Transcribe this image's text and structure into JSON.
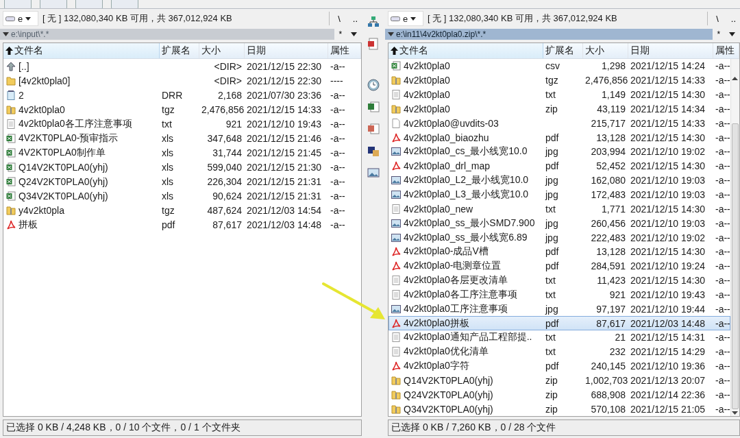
{
  "panels": [
    {
      "active": false,
      "drive": "e",
      "free": "[ 无 ] 132,080,340 KB 可用，共 367,012,924 KB",
      "root": "\\",
      "up": "..",
      "path": "e:\\input\\*.*",
      "filter": "*",
      "columns": [
        {
          "label": "文件名",
          "sorted": true
        },
        {
          "label": "扩展名",
          "sorted": false
        },
        {
          "label": "大小",
          "sorted": false
        },
        {
          "label": "日期",
          "sorted": false
        },
        {
          "label": "属性",
          "sorted": false
        }
      ],
      "rows": [
        {
          "kind": "parent",
          "name": "[..]",
          "size": "<DIR>",
          "date": "2021/12/15 22:30",
          "attr": "-a--",
          "selected": false
        },
        {
          "kind": "folder",
          "name": "[4v2kt0pla0]",
          "size": "<DIR>",
          "date": "2021/12/15 22:30",
          "attr": "----",
          "selected": false
        },
        {
          "kind": "note",
          "name": "2",
          "ext": "DRR",
          "size": "2,168",
          "date": "2021/07/30 23:36",
          "attr": "-a--",
          "selected": false
        },
        {
          "kind": "archive",
          "name": "4v2kt0pla0",
          "ext": "tgz",
          "size": "2,476,856",
          "date": "2021/12/15 14:33",
          "attr": "-a--",
          "selected": false
        },
        {
          "kind": "text",
          "name": "4v2kt0pla0各工序注意事项",
          "ext": "txt",
          "size": "921",
          "date": "2021/12/10 19:43",
          "attr": "-a--",
          "selected": false
        },
        {
          "kind": "sheet",
          "name": "4V2KT0PLA0-预审指示",
          "ext": "xls",
          "size": "347,648",
          "date": "2021/12/15 21:46",
          "attr": "-a--",
          "selected": false
        },
        {
          "kind": "sheet",
          "name": "4V2KT0PLA0制作单",
          "ext": "xls",
          "size": "31,744",
          "date": "2021/12/15 21:45",
          "attr": "-a--",
          "selected": false
        },
        {
          "kind": "sheet",
          "name": "Q14V2KT0PLA0(yhj)",
          "ext": "xls",
          "size": "599,040",
          "date": "2021/12/15 21:30",
          "attr": "-a--",
          "selected": false
        },
        {
          "kind": "sheet",
          "name": "Q24V2KT0PLA0(yhj)",
          "ext": "xls",
          "size": "226,304",
          "date": "2021/12/15 21:31",
          "attr": "-a--",
          "selected": false
        },
        {
          "kind": "sheet",
          "name": "Q34V2KT0PLA0(yhj)",
          "ext": "xls",
          "size": "90,624",
          "date": "2021/12/15 21:31",
          "attr": "-a--",
          "selected": false
        },
        {
          "kind": "archive",
          "name": "y4v2kt0pla",
          "ext": "tgz",
          "size": "487,624",
          "date": "2021/12/03 14:54",
          "attr": "-a--",
          "selected": false
        },
        {
          "kind": "pdf",
          "name": "拼板",
          "ext": "pdf",
          "size": "87,617",
          "date": "2021/12/03 14:48",
          "attr": "-a--",
          "selected": false
        }
      ],
      "status": "已选择 0 KB / 4,248 KB，0 / 10 个文件，0 / 1 个文件夹"
    },
    {
      "active": true,
      "drive": "e",
      "free": "[ 无 ] 132,080,340 KB 可用，共 367,012,924 KB",
      "root": "\\",
      "up": "..",
      "path": "e:\\in11\\4v2kt0pla0.zip\\*.*",
      "filter": "*",
      "columns": [
        {
          "label": "文件名",
          "sorted": true
        },
        {
          "label": "扩展名",
          "sorted": false
        },
        {
          "label": "大小",
          "sorted": false
        },
        {
          "label": "日期",
          "sorted": false
        },
        {
          "label": "属性",
          "sorted": false
        }
      ],
      "rows": [
        {
          "kind": "csv",
          "name": "4v2kt0pla0",
          "ext": "csv",
          "size": "1,298",
          "date": "2021/12/15 14:24",
          "attr": "-a--",
          "selected": false
        },
        {
          "kind": "archive",
          "name": "4v2kt0pla0",
          "ext": "tgz",
          "size": "2,476,856",
          "date": "2021/12/15 14:33",
          "attr": "-a--",
          "selected": false
        },
        {
          "kind": "text",
          "name": "4v2kt0pla0",
          "ext": "txt",
          "size": "1,149",
          "date": "2021/12/15 14:30",
          "attr": "-a--",
          "selected": false
        },
        {
          "kind": "archive",
          "name": "4v2kt0pla0",
          "ext": "zip",
          "size": "43,119",
          "date": "2021/12/15 14:34",
          "attr": "-a--",
          "selected": false
        },
        {
          "kind": "file",
          "name": "4v2kt0pla0@uvdits-03",
          "size": "215,717",
          "date": "2021/12/15 14:33",
          "attr": "-a--",
          "selected": false
        },
        {
          "kind": "pdf",
          "name": "4v2kt0pla0_biaozhu",
          "ext": "pdf",
          "size": "13,128",
          "date": "2021/12/15 14:30",
          "attr": "-a--",
          "selected": false
        },
        {
          "kind": "image",
          "name": "4v2kt0pla0_cs_最小线宽10.0",
          "ext": "jpg",
          "size": "203,994",
          "date": "2021/12/10 19:02",
          "attr": "-a--",
          "selected": false
        },
        {
          "kind": "pdf",
          "name": "4v2kt0pla0_drl_map",
          "ext": "pdf",
          "size": "52,452",
          "date": "2021/12/15 14:30",
          "attr": "-a--",
          "selected": false
        },
        {
          "kind": "image",
          "name": "4v2kt0pla0_L2_最小线宽10.0",
          "ext": "jpg",
          "size": "162,080",
          "date": "2021/12/10 19:03",
          "attr": "-a--",
          "selected": false
        },
        {
          "kind": "image",
          "name": "4v2kt0pla0_L3_最小线宽10.0",
          "ext": "jpg",
          "size": "172,483",
          "date": "2021/12/10 19:03",
          "attr": "-a--",
          "selected": false
        },
        {
          "kind": "text",
          "name": "4v2kt0pla0_new",
          "ext": "txt",
          "size": "1,771",
          "date": "2021/12/15 14:30",
          "attr": "-a--",
          "selected": false
        },
        {
          "kind": "image",
          "name": "4v2kt0pla0_ss_最小SMD7.900",
          "ext": "jpg",
          "size": "260,456",
          "date": "2021/12/10 19:03",
          "attr": "-a--",
          "selected": false
        },
        {
          "kind": "image",
          "name": "4v2kt0pla0_ss_最小线宽6.89",
          "ext": "jpg",
          "size": "222,483",
          "date": "2021/12/10 19:02",
          "attr": "-a--",
          "selected": false
        },
        {
          "kind": "pdf",
          "name": "4v2kt0pla0-成品V槽",
          "ext": "pdf",
          "size": "13,128",
          "date": "2021/12/15 14:30",
          "attr": "-a--",
          "selected": false
        },
        {
          "kind": "pdf",
          "name": "4v2kt0pla0-电测章位置",
          "ext": "pdf",
          "size": "284,591",
          "date": "2021/12/10 19:24",
          "attr": "-a--",
          "selected": false
        },
        {
          "kind": "text",
          "name": "4v2kt0pla0各层更改清单",
          "ext": "txt",
          "size": "11,423",
          "date": "2021/12/15 14:30",
          "attr": "-a--",
          "selected": false
        },
        {
          "kind": "text",
          "name": "4v2kt0pla0各工序注意事项",
          "ext": "txt",
          "size": "921",
          "date": "2021/12/10 19:43",
          "attr": "-a--",
          "selected": false
        },
        {
          "kind": "image",
          "name": "4v2kt0pla0工序注意事项",
          "ext": "jpg",
          "size": "97,197",
          "date": "2021/12/10 19:44",
          "attr": "-a--",
          "selected": false
        },
        {
          "kind": "pdf",
          "name": "4v2kt0pla0拼板",
          "ext": "pdf",
          "size": "87,617",
          "date": "2021/12/03 14:48",
          "attr": "-a--",
          "selected": true
        },
        {
          "kind": "text",
          "name": "4v2kt0pla0通知产品工程部提..",
          "ext": "txt",
          "size": "21",
          "date": "2021/12/15 14:31",
          "attr": "-a--",
          "selected": false
        },
        {
          "kind": "text",
          "name": "4v2kt0pla0优化清单",
          "ext": "txt",
          "size": "232",
          "date": "2021/12/15 14:29",
          "attr": "-a--",
          "selected": false
        },
        {
          "kind": "pdf",
          "name": "4v2kt0pla0字符",
          "ext": "pdf",
          "size": "240,145",
          "date": "2021/12/10 19:36",
          "attr": "-a--",
          "selected": false
        },
        {
          "kind": "archive",
          "name": "Q14V2KT0PLA0(yhj)",
          "ext": "zip",
          "size": "1,002,703",
          "date": "2021/12/13 20:07",
          "attr": "-a--",
          "selected": false
        },
        {
          "kind": "archive",
          "name": "Q24V2KT0PLA0(yhj)",
          "ext": "zip",
          "size": "688,908",
          "date": "2021/12/14 22:36",
          "attr": "-a--",
          "selected": false
        },
        {
          "kind": "archive",
          "name": "Q34V2KT0PLA0(yhj)",
          "ext": "zip",
          "size": "570,108",
          "date": "2021/12/15 21:05",
          "attr": "-a--",
          "selected": false
        }
      ],
      "status": "已选择 0 KB / 7,260 KB，0 / 28 个文件"
    }
  ]
}
